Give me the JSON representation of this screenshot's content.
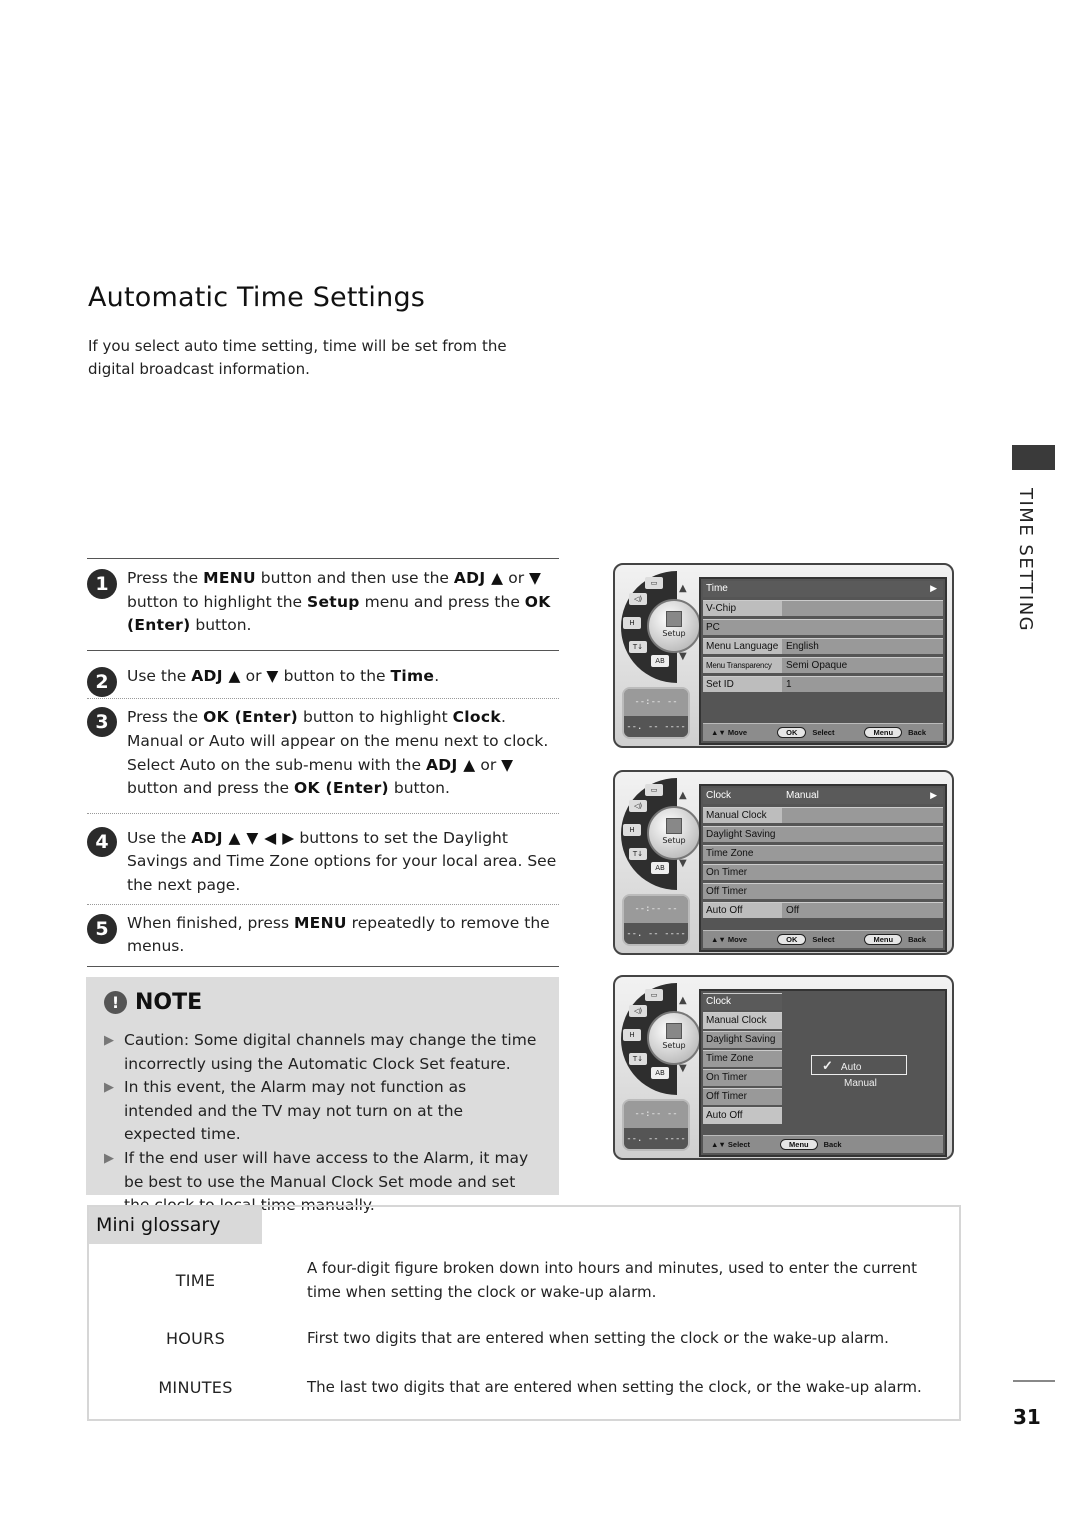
{
  "page": {
    "title": "Automatic Time Settings",
    "intro": "If you select auto time setting, time will be set from the digital broadcast information.",
    "section_tab": "TIME SETTING",
    "page_number": "31"
  },
  "steps": [
    {
      "num": "1",
      "parts": [
        "Press the ",
        "MENU",
        " button and then use the ",
        "ADJ ▲",
        " or ",
        "▼",
        " button to highlight the ",
        "Setup",
        " menu and press the ",
        "OK (Enter)",
        " button."
      ]
    },
    {
      "num": "2",
      "parts": [
        "Use the ",
        "ADJ ▲",
        " or ",
        "▼",
        "  button to the ",
        "Time",
        "."
      ]
    },
    {
      "num": "3",
      "parts": [
        "Press the ",
        "OK (Enter)",
        " button to highlight ",
        "Clock",
        ". Manual or Auto will appear on the menu next to clock. Select Auto on the sub-menu with the ",
        "ADJ ▲",
        " or ",
        "▼",
        " button and press the ",
        "OK (Enter)",
        " button."
      ]
    },
    {
      "num": "4",
      "parts": [
        "Use the ",
        "ADJ ▲ ▼ ◀ ▶",
        " buttons to set the Daylight Savings and Time Zone options for your local area. See the next page."
      ]
    },
    {
      "num": "5",
      "parts": [
        "When finished, press ",
        "MENU",
        " repeatedly to remove the menus."
      ]
    }
  ],
  "note": {
    "icon": "exclamation-icon",
    "title": "NOTE",
    "items": [
      "Caution: Some digital channels may change the time incorrectly using the Automatic Clock Set feature.",
      "In this event, the Alarm may not function as intended and the TV may not turn on at the expected time.",
      "If the end user will have access to the Alarm, it may be best to use the Manual Clock Set mode and set the clock to local time manually."
    ]
  },
  "osd_common": {
    "dial_center_label": "Setup",
    "dial_segments": [
      "▭",
      "◁)",
      "H",
      "T↓",
      "AB"
    ],
    "clock_top": "--:-- --",
    "clock_bottom": "--. -- ----",
    "footer_move": "▲▼ Move",
    "footer_ok": "OK",
    "footer_select": "Select",
    "footer_menu": "Menu",
    "footer_back": "Back",
    "footer_select_only": "▲▼ Select"
  },
  "osd1": {
    "header": "Time",
    "rows": [
      {
        "label": "V-Chip",
        "value": ""
      },
      {
        "label": "PC",
        "value": ""
      },
      {
        "label": "Menu Language",
        "value": "English"
      },
      {
        "label": "Menu Transparency",
        "value": "Semi Opaque"
      },
      {
        "label": "Set ID",
        "value": "1"
      }
    ]
  },
  "osd2": {
    "header": "Clock",
    "header_value": "Manual",
    "rows": [
      {
        "label": "Manual Clock",
        "value": ""
      },
      {
        "label": "Daylight Saving",
        "value": ""
      },
      {
        "label": "Time Zone",
        "value": ""
      },
      {
        "label": "On Timer",
        "value": ""
      },
      {
        "label": "Off Timer",
        "value": ""
      },
      {
        "label": "Auto Off",
        "value": "Off"
      }
    ]
  },
  "osd3": {
    "rows": [
      "Clock",
      "Manual Clock",
      "Daylight Saving",
      "Time Zone",
      "On Timer",
      "Off Timer",
      "Auto Off"
    ],
    "options": [
      {
        "label": "Auto",
        "selected": true
      },
      {
        "label": "Manual",
        "selected": false
      }
    ]
  },
  "glossary": {
    "title": "Mini glossary",
    "entries": [
      {
        "term": "TIME",
        "definition": "A four-digit figure broken down into hours and minutes, used to enter the current time when setting the clock or wake-up alarm."
      },
      {
        "term": "HOURS",
        "definition": "First two digits that are entered when setting the clock or the wake-up alarm."
      },
      {
        "term": "MINUTES",
        "definition": "The last two digits that are entered when setting the clock, or the wake-up alarm."
      }
    ]
  }
}
